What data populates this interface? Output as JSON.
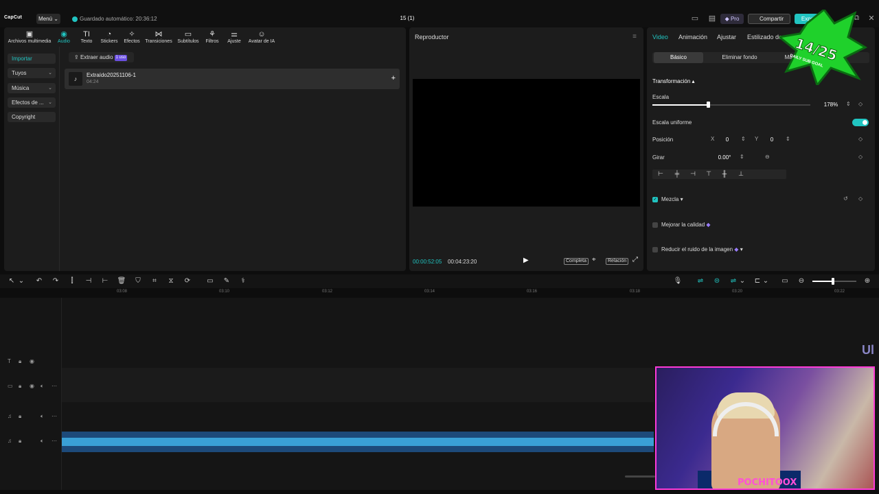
{
  "titlebar": {
    "logo": "CapCut",
    "menu_label": "Menú",
    "autosave": "Guardado automático: 20:36:12",
    "project_title": "15 (1)",
    "pro_label": "Pro",
    "share_label": "Compartir",
    "export_label": "Exportar"
  },
  "media_tabs": [
    {
      "label": "Archivos multimedia",
      "icon": "media-icon"
    },
    {
      "label": "Audio",
      "icon": "audio-icon"
    },
    {
      "label": "Texto",
      "icon": "text-icon"
    },
    {
      "label": "Stickers",
      "icon": "sticker-icon"
    },
    {
      "label": "Efectos",
      "icon": "effects-icon"
    },
    {
      "label": "Transiciones",
      "icon": "transitions-icon"
    },
    {
      "label": "Subtítulos",
      "icon": "subtitles-icon"
    },
    {
      "label": "Filtros",
      "icon": "filters-icon"
    },
    {
      "label": "Ajuste",
      "icon": "adjust-icon"
    },
    {
      "label": "Avatar de IA",
      "icon": "ai-avatar-icon"
    }
  ],
  "sidebar": {
    "items": [
      {
        "label": "Importar"
      },
      {
        "label": "Tuyos"
      },
      {
        "label": "Música"
      },
      {
        "label": "Efectos de ..."
      },
      {
        "label": "Copyright"
      }
    ]
  },
  "media": {
    "extract_label": "Extraer audio",
    "extract_badge": "1 uso",
    "file_name": "Extraído20251106-1",
    "file_duration": "04:24"
  },
  "player": {
    "title": "Reproductor",
    "current_time": "00:00:52:05",
    "total_time": "00:04:23:20",
    "full_label": "Completa",
    "ratio_label": "Relación"
  },
  "props": {
    "tabs": [
      "Video",
      "Animación",
      "Ajustar",
      "Estilizado de"
    ],
    "subtabs": [
      "Básico",
      "Eliminar fondo",
      "Máscara"
    ],
    "transform_title": "Transformación",
    "scale_label": "Escala",
    "scale_value": "178%",
    "uniform_label": "Escala uniforme",
    "position_label": "Posición",
    "pos_x_label": "X",
    "pos_x": "0",
    "pos_y_label": "Y",
    "pos_y": "0",
    "rotate_label": "Girar",
    "rotate_value": "0.00°",
    "blend_label": "Mezcla",
    "quality_label": "Mejorar la calidad",
    "denoise_label": "Reducir el ruido de la imagen"
  },
  "timeline": {
    "ticks": [
      "03:08",
      "03:10",
      "03:12",
      "03:14",
      "03:16",
      "03:18",
      "03:20",
      "03:22"
    ]
  },
  "overlay": {
    "goal_count": "14/25",
    "goal_label": "DAILY SUB GOAL",
    "cam_name": "POCHITOOX",
    "ghost_text": "Ul"
  },
  "colors": {
    "accent": "#21c4c1",
    "background": "#0d0d0d",
    "panel": "#1c1c1c",
    "audio_clip": "#1d4a7a",
    "webcam_border": "#ff3bd8"
  }
}
